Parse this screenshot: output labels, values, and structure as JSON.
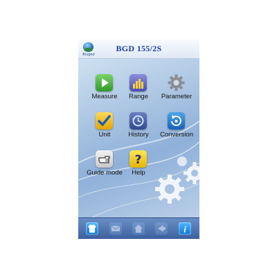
{
  "header": {
    "title": "BGD  155/2S",
    "logo_text": "Biuged"
  },
  "menu": {
    "items": [
      {
        "label": "Measure",
        "icon": "play-icon"
      },
      {
        "label": "Range",
        "icon": "bar-chart-icon"
      },
      {
        "label": "Parameter",
        "icon": "gear-icon"
      },
      {
        "label": "Unit",
        "icon": "checkmark-icon"
      },
      {
        "label": "History",
        "icon": "clock-history-icon"
      },
      {
        "label": "Conversion",
        "icon": "refresh-icon"
      },
      {
        "label": "Guide mode",
        "icon": "pointing-hand-icon"
      },
      {
        "label": "Help",
        "icon": "question-icon"
      }
    ]
  },
  "bottom_bar": {
    "buttons": [
      {
        "icon": "shirt-icon",
        "state": "active"
      },
      {
        "icon": "envelope-icon",
        "state": "inactive"
      },
      {
        "icon": "home-icon",
        "state": "inactive"
      },
      {
        "icon": "back-icon",
        "state": "inactive"
      },
      {
        "icon": "info-icon",
        "state": "active"
      }
    ]
  },
  "colors": {
    "title": "#1d3f9e",
    "background": "#a9c4e2",
    "bottom_bar": "#3a5f9c",
    "active_button": "#0b76d6"
  }
}
